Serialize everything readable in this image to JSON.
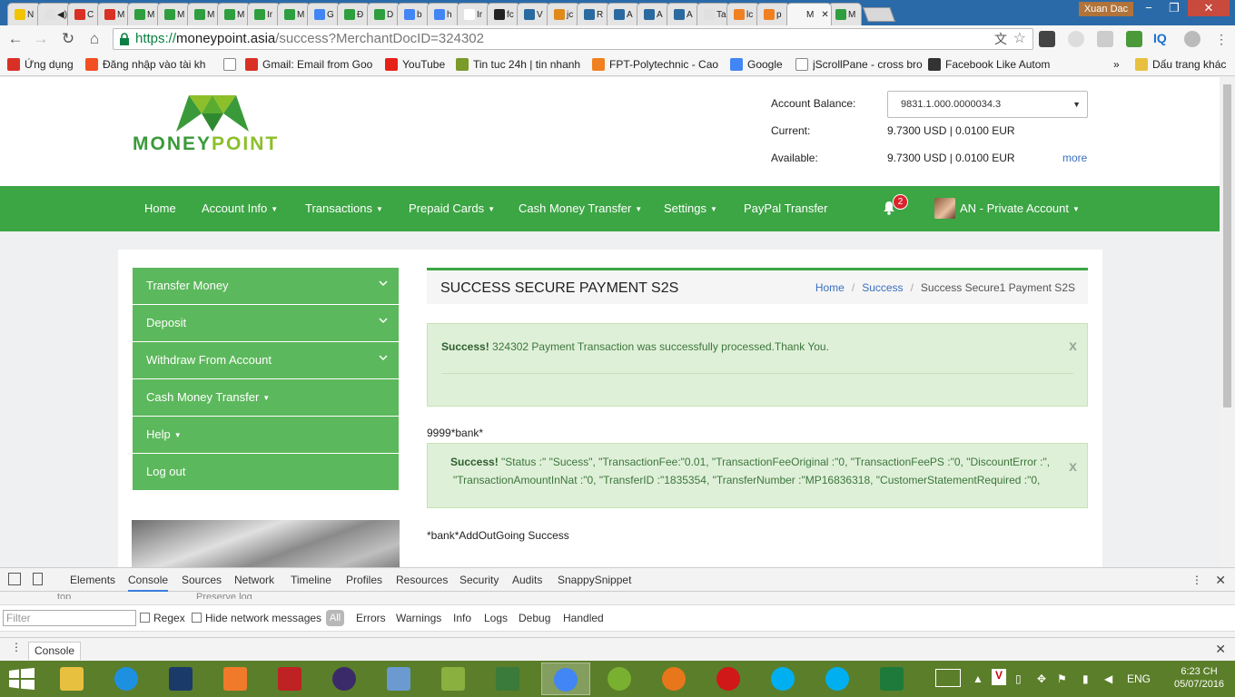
{
  "browser": {
    "tabs": [
      {
        "label": "N",
        "color": "#f2c400"
      },
      {
        "label": "◀)",
        "color": "#e0e0e0"
      },
      {
        "label": "C",
        "color": "#d93025"
      },
      {
        "label": "M",
        "color": "#d93025"
      },
      {
        "label": "M",
        "color": "#2e9e3e"
      },
      {
        "label": "M",
        "color": "#2e9e3e"
      },
      {
        "label": "M",
        "color": "#2e9e3e"
      },
      {
        "label": "M",
        "color": "#2e9e3e"
      },
      {
        "label": "Ir",
        "color": "#2e9e3e"
      },
      {
        "label": "M",
        "color": "#2e9e3e"
      },
      {
        "label": "G",
        "color": "#4285f4"
      },
      {
        "label": "Đ",
        "color": "#2e9e3e"
      },
      {
        "label": "D",
        "color": "#2e9e3e"
      },
      {
        "label": "b",
        "color": "#4285f4"
      },
      {
        "label": "h",
        "color": "#4285f4"
      },
      {
        "label": "Ir",
        "color": "#ffffff"
      },
      {
        "label": "fc",
        "color": "#222222"
      },
      {
        "label": "V",
        "color": "#2a6aa0"
      },
      {
        "label": "jc",
        "color": "#e08a1a"
      },
      {
        "label": "R",
        "color": "#2a6aa0"
      },
      {
        "label": "A",
        "color": "#2a6aa0"
      },
      {
        "label": "A",
        "color": "#2a6aa0"
      },
      {
        "label": "A",
        "color": "#2a6aa0"
      },
      {
        "label": "Tab",
        "color": "#e0e0e0"
      },
      {
        "label": "lc",
        "color": "#f08020"
      },
      {
        "label": "p",
        "color": "#f08020"
      },
      {
        "label": "M",
        "color": "#f6f6f6"
      },
      {
        "label": "M",
        "color": "#2e9e3e"
      }
    ],
    "user_name": "Xuan Dac",
    "url_scheme": "https://",
    "url_host": "moneypoint.asia",
    "url_path": "/success?MerchantDocID=324302",
    "bookmarks": [
      {
        "label": "Ứng dụng",
        "color": "#d93025"
      },
      {
        "label": "Đăng nhập vào tài kh",
        "color": "#f25022"
      },
      {
        "label": "",
        "color": "#ffffff"
      },
      {
        "label": "Gmail: Email from Goo",
        "color": "#d93025"
      },
      {
        "label": "YouTube",
        "color": "#e62117"
      },
      {
        "label": "Tin tuc 24h | tin nhanh",
        "color": "#7a9a2a"
      },
      {
        "label": "FPT-Polytechnic - Cao",
        "color": "#f08020"
      },
      {
        "label": "Google",
        "color": "#4285f4"
      },
      {
        "label": "jScrollPane - cross bro",
        "color": "#ffffff"
      },
      {
        "label": "Facebook Like Autom",
        "color": "#333333"
      }
    ],
    "bookmarks_overflow": "»",
    "other_bookmarks": "Dấu trang khác"
  },
  "site": {
    "logo_part1": "MONEY",
    "logo_part2": "POINT",
    "account_balance_label": "Account Balance:",
    "account_select_value": "9831.1.000.0000034.3",
    "current_label": "Current:",
    "current_value": "9.7300 USD | 0.0100 EUR",
    "available_label": "Available:",
    "available_value": "9.7300 USD | 0.0100 EUR",
    "more_link": "more",
    "nav": {
      "home": "Home",
      "account_info": "Account Info",
      "transactions": "Transactions",
      "prepaid_cards": "Prepaid Cards",
      "cash_money_transfer": "Cash Money Transfer",
      "settings": "Settings",
      "paypal_transfer": "PayPal Transfer",
      "notification_count": "2",
      "account_name": "AN - Private Account"
    },
    "sidebar": {
      "items": [
        {
          "label": "Transfer Money"
        },
        {
          "label": "Deposit"
        },
        {
          "label": "Withdraw From Account"
        },
        {
          "label": "Cash Money Transfer"
        },
        {
          "label": "Help"
        },
        {
          "label": "Log out"
        }
      ]
    },
    "page_title": "SUCCESS SECURE PAYMENT S2S",
    "breadcrumb": [
      "Home",
      "Success",
      "Success Secure1 Payment S2S"
    ],
    "alert1_strong": "Success!",
    "alert1_text": "324302 Payment Transaction was successfully processed.Thank You.",
    "text_bank": "9999*bank*",
    "alert2_strong": "Success!",
    "alert2_line1": "\"Status :\" \"Sucess\", \"TransactionFee:\"0.01, \"TransactionFeeOriginal :\"0, \"TransactionFeePS :\"0, \"DiscountError :\",",
    "alert2_line2": "\"TransactionAmountInNat :\"0, \"TransferID :\"1835354, \"TransferNumber :\"MP16836318, \"CustomerStatementRequired :\"0,",
    "text_addout": "*bank*AddOutGoing Success",
    "alert_close": "x"
  },
  "devtools": {
    "tabs": [
      "Elements",
      "Console",
      "Sources",
      "Network",
      "Timeline",
      "Profiles",
      "Resources",
      "Security",
      "Audits",
      "SnappySnippet"
    ],
    "ghost_top": "top",
    "ghost_preserve": "Preserve log",
    "filter_placeholder": "Filter",
    "regex": "Regex",
    "hide_network": "Hide network messages",
    "all": "All",
    "levels": [
      "Errors",
      "Warnings",
      "Info",
      "Logs",
      "Debug",
      "Handled"
    ],
    "drawer_tab": "Console"
  },
  "taskbar": {
    "apps": [
      {
        "name": "explorer",
        "color": "#e8c040"
      },
      {
        "name": "ie",
        "color": "#1e90e0"
      },
      {
        "name": "photoshop",
        "color": "#1a3a6a"
      },
      {
        "name": "xampp",
        "color": "#f07a2a"
      },
      {
        "name": "filezilla",
        "color": "#bf2222"
      },
      {
        "name": "eclipse",
        "color": "#3a2a6a"
      },
      {
        "name": "virtualbox",
        "color": "#6a9ad0"
      },
      {
        "name": "notepad",
        "color": "#8ab040"
      },
      {
        "name": "tool",
        "color": "#3a7a3a"
      },
      {
        "name": "chrome",
        "color": "#4285f4"
      },
      {
        "name": "clock-app",
        "color": "#7ab030"
      },
      {
        "name": "firefox",
        "color": "#e8761a"
      },
      {
        "name": "opera",
        "color": "#d01818"
      },
      {
        "name": "skype",
        "color": "#00aff0"
      },
      {
        "name": "skype2",
        "color": "#00aff0"
      },
      {
        "name": "excel",
        "color": "#1d7a3a"
      }
    ],
    "language": "ENG",
    "time": "6:23 CH",
    "date": "05/07/2016"
  }
}
